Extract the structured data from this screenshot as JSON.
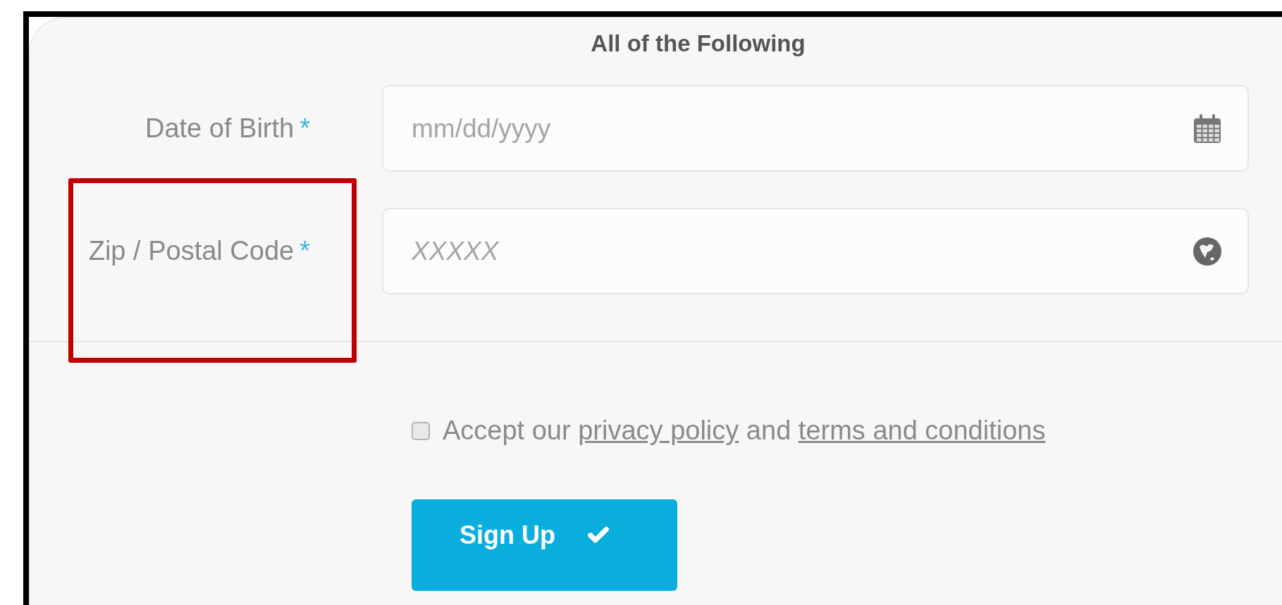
{
  "heading": "All of the Following",
  "fields": [
    {
      "label": "Date of Birth",
      "required_mark": "*",
      "placeholder": "mm/dd/yyyy",
      "kind": "date"
    },
    {
      "label": "Zip / Postal Code",
      "required_mark": "*",
      "placeholder": "XXXXX",
      "kind": "postal"
    }
  ],
  "consent": {
    "checked": false,
    "parts": [
      {
        "kind": "text",
        "text": "Accept our"
      },
      {
        "kind": "link",
        "text": "privacy policy"
      },
      {
        "kind": "text",
        "text": "and"
      },
      {
        "kind": "link",
        "text": "terms and conditions"
      }
    ]
  },
  "submit": {
    "label": "Sign Up"
  }
}
